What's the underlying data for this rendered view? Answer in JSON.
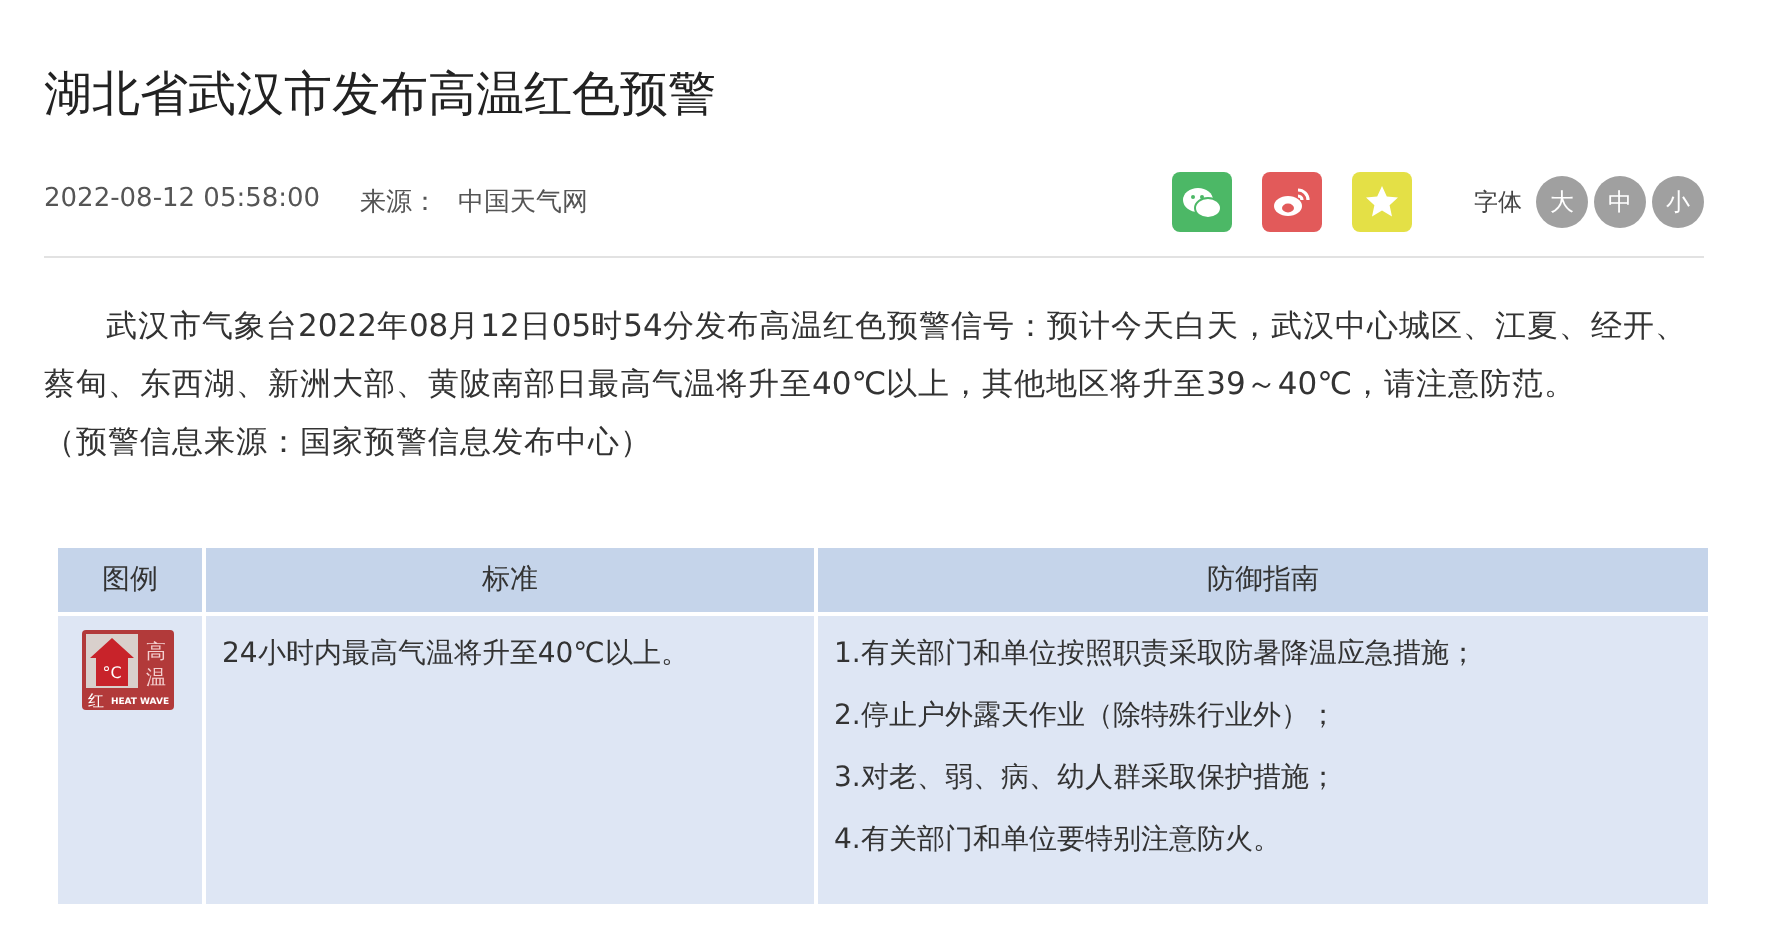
{
  "title": "湖北省武汉市发布高温红色预警",
  "meta": {
    "datetime": "2022-08-12 05:58:00",
    "source_label": "来源：",
    "source": "中国天气网"
  },
  "share_buttons": [
    {
      "kind": "wechat"
    },
    {
      "kind": "weibo"
    },
    {
      "kind": "favorite"
    }
  ],
  "font_size": {
    "label": "字体",
    "options": [
      "大",
      "中",
      "小"
    ]
  },
  "paragraphs": [
    "武汉市气象台2022年08月12日05时54分发布高温红色预警信号：预计今天白天，武汉中心城区、江夏、经开、蔡甸、东西湖、新洲大部、黄陂南部日最高气温将升至40℃以上，其他地区将升至39～40℃，请注意防范。",
    "（预警信息来源：国家预警信息发布中心）"
  ],
  "table": {
    "columns": [
      "图例",
      "标准",
      "防御指南"
    ],
    "rows": [
      {
        "legend": {
          "unit": "°C",
          "level": "红",
          "name": [
            "高",
            "温"
          ],
          "english": "HEAT WAVE"
        },
        "standard": "24小时内最高气温将升至40℃以上。",
        "guide": [
          "1.有关部门和单位按照职责采取防暑降温应急措施；",
          "2.停止户外露天作业（除特殊行业外）；",
          "3.对老、弱、病、幼人群采取保护措施；",
          "4.有关部门和单位要特别注意防火。"
        ]
      }
    ]
  }
}
